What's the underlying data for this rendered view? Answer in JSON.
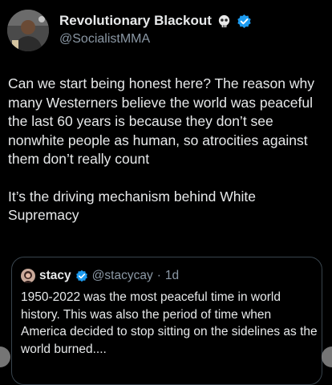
{
  "author": {
    "display_name": "Revolutionary Blackout",
    "handle": "@SocialistMMA",
    "avatar_icon": "profile-avatar",
    "name_emoji_icon": "rocket-skull-icon",
    "verified_icon": "verified-badge-icon"
  },
  "tweet": {
    "paragraphs": [
      "Can we start being honest here? The reason why many Westerners believe the world was peaceful the last 60 years is because they don’t see nonwhite people as human, so atrocities against them don’t really count",
      "It’s the driving mechanism behind White Supremacy"
    ]
  },
  "quoted": {
    "display_name": "stacy",
    "handle": "@stacycay",
    "dot": "·",
    "time": "1d",
    "text": "1950-2022 was the most peaceful time in world history. This was also the period of time when America decided to stop sitting on the sidelines as the world burned...."
  },
  "colors": {
    "background": "#000000",
    "text": "#e7e9ea",
    "muted": "#8b98a5",
    "verified": "#1d9bf0",
    "border": "#38444d"
  }
}
